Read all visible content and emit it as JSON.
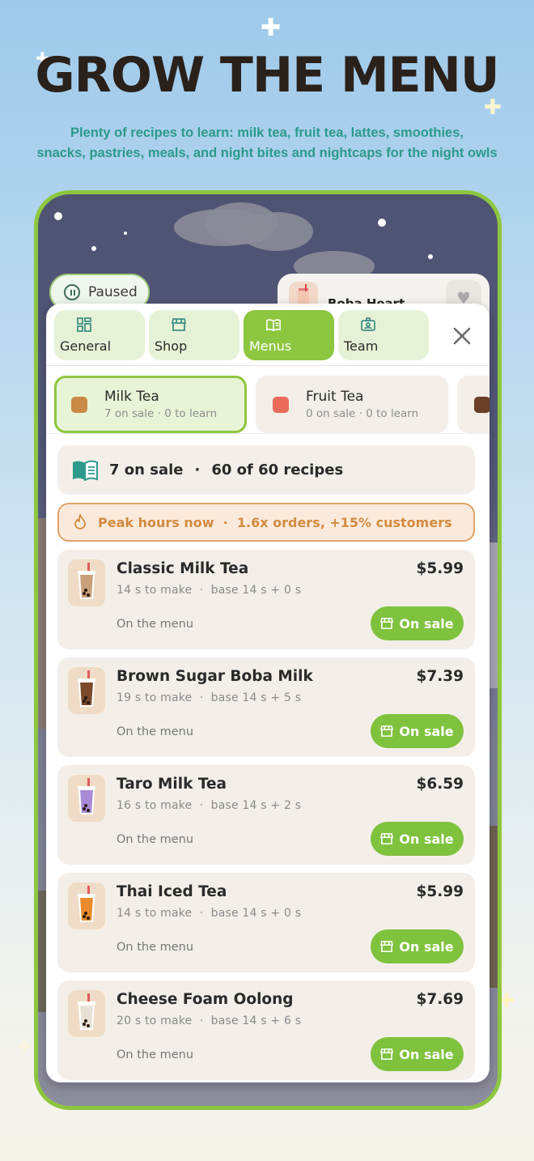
{
  "headline": "GROW THE MENU",
  "subline_1": "Plenty of recipes to learn: milk tea, fruit tea, lattes, smoothies,",
  "subline_2": "snacks, pastries, meals, and night bites and nightcaps for the night owls",
  "game": {
    "paused_label": "Paused",
    "shop_name": "Boba Heart"
  },
  "tabs": [
    {
      "label": "General",
      "icon": "dashboard-icon",
      "active": false
    },
    {
      "label": "Shop",
      "icon": "storefront-icon",
      "active": false
    },
    {
      "label": "Menus",
      "icon": "book-icon",
      "active": true
    },
    {
      "label": "Team",
      "icon": "id-badge-icon",
      "active": false
    }
  ],
  "categories": [
    {
      "name": "Milk Tea",
      "sub": "7 on sale · 0 to learn",
      "color": "#c98a45",
      "active": true
    },
    {
      "name": "Fruit Tea",
      "sub": "0 on sale · 0 to learn",
      "color": "#e96b5b",
      "active": false
    },
    {
      "name": "",
      "sub": "",
      "color": "#6b3f28",
      "active": false
    }
  ],
  "summary": {
    "on_sale": "7 on sale",
    "separator": "·",
    "recipes": "60 of 60 recipes"
  },
  "peak": {
    "text": "Peak hours now  ·  1.6x orders, +15% customers"
  },
  "recipes": [
    {
      "name": "Classic Milk Tea",
      "price": "$5.99",
      "time": "14 s to make  ·  base 14 s + 0 s",
      "status": "On the menu",
      "button": "On sale",
      "drink_color": "#c9a07a"
    },
    {
      "name": "Brown Sugar Boba Milk",
      "price": "$7.39",
      "time": "19 s to make  ·  base 14 s + 5 s",
      "status": "On the menu",
      "button": "On sale",
      "drink_color": "#7a4a2a"
    },
    {
      "name": "Taro Milk Tea",
      "price": "$6.59",
      "time": "16 s to make  ·  base 14 s + 2 s",
      "status": "On the menu",
      "button": "On sale",
      "drink_color": "#a88ad6"
    },
    {
      "name": "Thai Iced Tea",
      "price": "$5.99",
      "time": "14 s to make  ·  base 14 s + 0 s",
      "status": "On the menu",
      "button": "On sale",
      "drink_color": "#ea8a2a"
    },
    {
      "name": "Cheese Foam Oolong",
      "price": "$7.69",
      "time": "20 s to make  ·  base 14 s + 6 s",
      "status": "On the menu",
      "button": "On sale",
      "drink_color": "#e8e2d6"
    }
  ],
  "colors": {
    "accent_green": "#8dc63f",
    "headline": "#2a211b",
    "subline_teal": "#2c9a8c",
    "peak_orange": "#d28b3f"
  }
}
